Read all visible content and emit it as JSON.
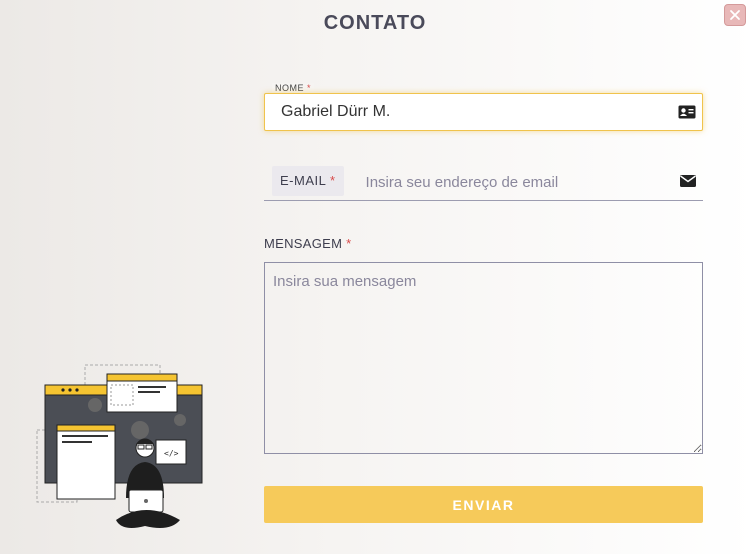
{
  "modal": {
    "title": "CONTATO",
    "close_icon": "close-icon"
  },
  "form": {
    "name": {
      "label": "NOME",
      "required_mark": "*",
      "value": "Gabriel Dürr M.",
      "icon": "contact-card-icon"
    },
    "email": {
      "label": "E-MAIL",
      "required_mark": "*",
      "placeholder": "Insira seu endereço de email",
      "value": "",
      "icon": "envelope-icon"
    },
    "message": {
      "label": "MENSAGEM",
      "required_mark": "*",
      "placeholder": "Insira sua mensagem",
      "value": ""
    },
    "submit_label": "ENVIAR"
  },
  "colors": {
    "accent": "#f6ca5a",
    "focus_border": "#f0c34c",
    "required": "#d84a4a",
    "close_bg": "#e8b8b8"
  }
}
